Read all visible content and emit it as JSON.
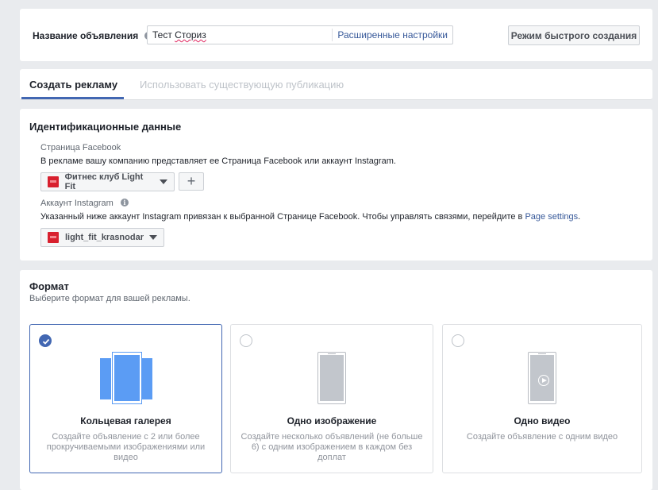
{
  "ad_name": {
    "label": "Название объявления",
    "value_prefix": "Тест ",
    "value_misspelled": "Сториз",
    "advanced_link": "Расширенные настройки",
    "quick_mode_button": "Режим быстрого создания"
  },
  "tabs": {
    "create": "Создать рекламу",
    "existing": "Использовать существующую публикацию"
  },
  "identity": {
    "title": "Идентификационные данные",
    "facebook_page_label": "Страница Facebook",
    "facebook_page_desc": "В рекламе вашу компанию представляет ее Страница Facebook или аккаунт Instagram.",
    "facebook_page_value": "Фитнес клуб Light Fit",
    "add_button": "+",
    "instagram_label": "Аккаунт Instagram",
    "instagram_desc": "Указанный ниже аккаунт Instagram привязан к выбранной Странице Facebook. Чтобы управлять связями, перейдите в",
    "instagram_link": "Page settings",
    "instagram_desc_end": ".",
    "instagram_value": "light_fit_krasnodar"
  },
  "format": {
    "title": "Формат",
    "subtitle": "Выберите формат для вашей рекламы.",
    "options": [
      {
        "title": "Кольцевая галерея",
        "desc": "Создайте объявление с 2 или более прокручиваемыми изображениями или видео",
        "selected": true,
        "icon": "carousel-icon"
      },
      {
        "title": "Одно изображение",
        "desc": "Создайте несколько объявлений (не больше 6) с одним изображением в каждом без доплат",
        "selected": false,
        "icon": "single-image-icon"
      },
      {
        "title": "Одно видео",
        "desc": "Создайте объявление с одним видео",
        "selected": false,
        "icon": "single-video-icon"
      }
    ]
  },
  "colors": {
    "accent": "#4267b2",
    "carousel_blue": "#5b9cf4",
    "page_logo_red": "#d8202e"
  }
}
